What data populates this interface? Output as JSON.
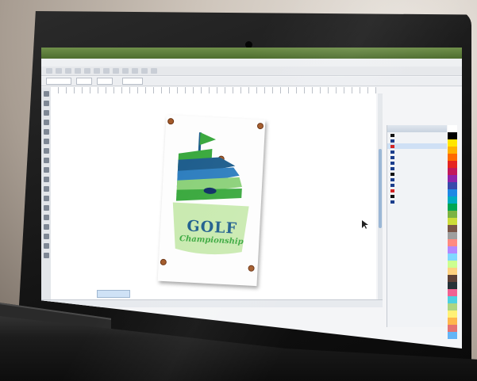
{
  "app": {
    "window_title": "",
    "zoom_level": ""
  },
  "menu": {
    "items": []
  },
  "document": {
    "logo_word": "GOLF",
    "logo_tagline": "Championship"
  },
  "dock": {
    "title": "",
    "rows": []
  },
  "status": {
    "text": ""
  },
  "colors": {
    "accent_green": "#4e6d2f",
    "logo_blue": "#1f5e8d",
    "logo_green": "#3ba93f",
    "logo_light_green": "#c9eab0",
    "handle_brown": "#a35a2a",
    "palette": [
      "#ffffff",
      "#000000",
      "#ffe600",
      "#ffb100",
      "#ff6a00",
      "#e52521",
      "#c2185b",
      "#8e24aa",
      "#3949ab",
      "#1e88e5",
      "#00acc1",
      "#00a651",
      "#7cb342",
      "#cddc39",
      "#795548",
      "#9e9e9e",
      "#ff8a80",
      "#b388ff",
      "#80d8ff",
      "#ccff90",
      "#ffd180",
      "#5d4037",
      "#263238",
      "#f06292",
      "#4dd0e1",
      "#aed581",
      "#fff176",
      "#ffb74d",
      "#e57373",
      "#64b5f6"
    ]
  },
  "icons": {
    "cursor": "arrow-cursor-icon",
    "tool": "tool-icon",
    "flag": "golf-flag-icon"
  }
}
